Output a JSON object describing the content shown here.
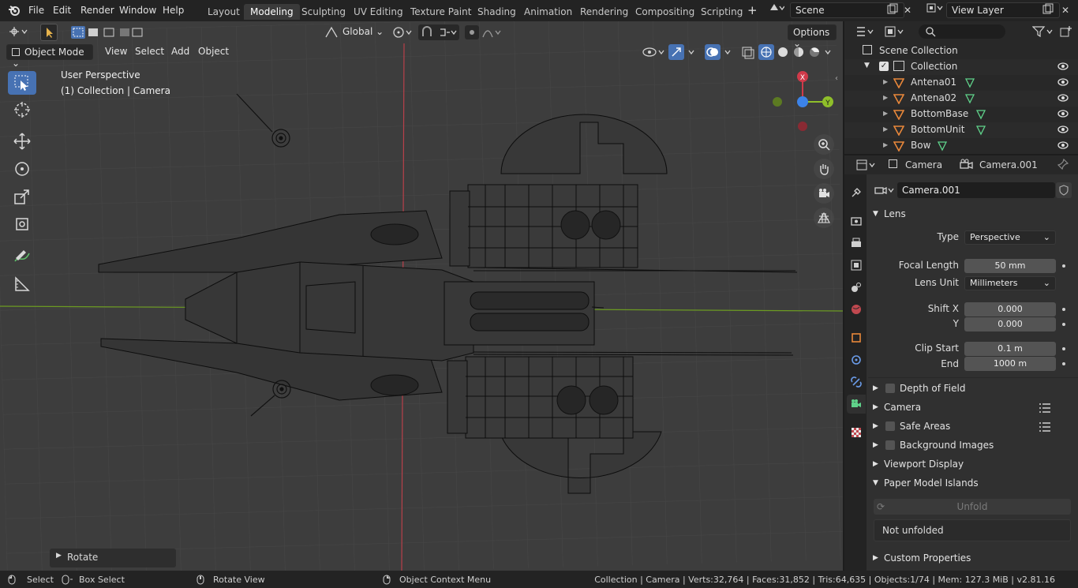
{
  "topbar": {
    "menus": [
      "File",
      "Edit",
      "Render",
      "Window",
      "Help"
    ],
    "workspaces": [
      "Layout",
      "Modeling",
      "Sculpting",
      "UV Editing",
      "Texture Paint",
      "Shading",
      "Animation",
      "Rendering",
      "Compositing",
      "Scripting"
    ],
    "active_workspace": "Modeling",
    "add_tab": "+",
    "scene": "Scene",
    "view_layer": "View Layer"
  },
  "viewport": {
    "transform_orientation": "Global",
    "options_label": "Options",
    "mode": "Object Mode",
    "menus": [
      "View",
      "Select",
      "Add",
      "Object"
    ],
    "overlay_line1": "User Perspective",
    "overlay_line2": "(1) Collection | Camera",
    "gizmo_axes": {
      "x": "X",
      "y": "Y"
    },
    "last_operator": "Rotate"
  },
  "outliner": {
    "root": "Scene Collection",
    "collection": "Collection",
    "objects": [
      "Antena01",
      "Antena02",
      "BottomBase",
      "BottomUnit",
      "Bow"
    ]
  },
  "properties": {
    "header_object": "Camera",
    "header_data": "Camera.001",
    "datablock_name": "Camera.001",
    "lens_panel": "Lens",
    "type_label": "Type",
    "type_value": "Perspective",
    "focal_length_label": "Focal Length",
    "focal_length_value": "50 mm",
    "lens_unit_label": "Lens Unit",
    "lens_unit_value": "Millimeters",
    "shift_x_label": "Shift X",
    "shift_x_value": "0.000",
    "shift_y_label": "Y",
    "shift_y_value": "0.000",
    "clip_start_label": "Clip Start",
    "clip_start_value": "0.1 m",
    "clip_end_label": "End",
    "clip_end_value": "1000 m",
    "panels": [
      "Depth of Field",
      "Camera",
      "Safe Areas",
      "Background Images",
      "Viewport Display",
      "Paper Model Islands"
    ],
    "unfold_button": "Unfold",
    "unfold_status": "Not unfolded",
    "custom_properties": "Custom Properties"
  },
  "statusbar": {
    "select": "Select",
    "box_select": "Box Select",
    "rotate_view": "Rotate View",
    "context_menu": "Object Context Menu",
    "stats": "Collection | Camera | Verts:32,764 | Faces:31,852 | Tris:64,635 | Objects:1/74 | Mem: 127.3 MiB | v2.81.16"
  },
  "colors": {
    "accent_blue": "#4772b3",
    "axis_x": "#d03a4a",
    "axis_y": "#8fbf2a",
    "axis_z": "#3c83e8",
    "object_orange": "#e8873a",
    "mesh_green": "#5fd28a"
  }
}
